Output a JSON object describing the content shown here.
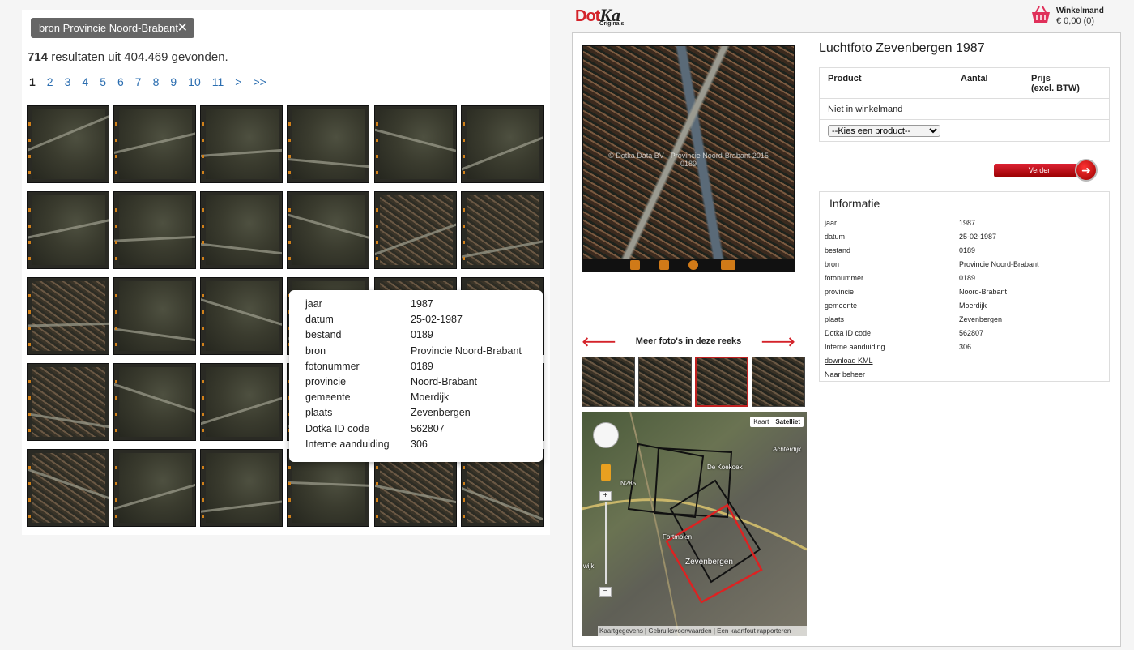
{
  "filter": {
    "label": "bron Provincie Noord-Brabant",
    "remove": "✕"
  },
  "results": {
    "count": "714",
    "text": " resultaten uit 404.469 gevonden."
  },
  "pagination": [
    "1",
    "2",
    "3",
    "4",
    "5",
    "6",
    "7",
    "8",
    "9",
    "10",
    "11",
    ">",
    ">>"
  ],
  "popup": {
    "rows": [
      {
        "k": "jaar",
        "v": "1987"
      },
      {
        "k": "datum",
        "v": "25-02-1987"
      },
      {
        "k": "bestand",
        "v": "0189"
      },
      {
        "k": "bron",
        "v": "Provincie Noord-Brabant"
      },
      {
        "k": "fotonummer",
        "v": "0189"
      },
      {
        "k": "provincie",
        "v": "Noord-Brabant"
      },
      {
        "k": "gemeente",
        "v": "Moerdijk"
      },
      {
        "k": "plaats",
        "v": "Zevenbergen"
      },
      {
        "k": "Dotka ID code",
        "v": "562807"
      },
      {
        "k": "Interne aanduiding",
        "v": "306"
      }
    ]
  },
  "brand": {
    "dot": "Dot",
    "ka": "Ka",
    "sub": "Originals"
  },
  "cart": {
    "title": "Winkelmand",
    "amount": "€ 0,00 (0)"
  },
  "product": {
    "title": "Luchtfoto Zevenbergen 1987",
    "headers": {
      "product": "Product",
      "aantal": "Aantal",
      "prijs": "Prijs",
      "prijs2": "(excl. BTW)"
    },
    "status": "Niet in winkelmand",
    "select": "--Kies een product--",
    "button": "Verder"
  },
  "photo": {
    "watermark1": "© Dotka Data BV - Provincie Noord-Brabant 2015",
    "watermark2": "0189"
  },
  "series": {
    "label": "Meer foto's in deze reeks",
    "prev": "🡐",
    "next": "🡒"
  },
  "map": {
    "btn_map": "Kaart",
    "btn_sat": "Satelliet",
    "footer": "Kaartgegevens | Gebruiksvoorwaarden | Een kaartfout rapporteren",
    "labels": [
      "Achterdijk",
      "De Koekoek",
      "N285",
      "Zevenbergen",
      "Fortmolen",
      "wijk"
    ]
  },
  "info": {
    "title": "Informatie",
    "rows": [
      {
        "k": "jaar",
        "v": "1987"
      },
      {
        "k": "datum",
        "v": "25-02-1987"
      },
      {
        "k": "bestand",
        "v": "0189"
      },
      {
        "k": "bron",
        "v": "Provincie Noord-Brabant"
      },
      {
        "k": "fotonummer",
        "v": "0189"
      },
      {
        "k": "provincie",
        "v": "Noord-Brabant"
      },
      {
        "k": "gemeente",
        "v": "Moerdijk"
      },
      {
        "k": "plaats",
        "v": "Zevenbergen"
      },
      {
        "k": "Dotka ID code",
        "v": "562807"
      },
      {
        "k": "Interne aanduiding",
        "v": "306"
      }
    ],
    "links": [
      "download KML",
      "Naar beheer"
    ]
  }
}
